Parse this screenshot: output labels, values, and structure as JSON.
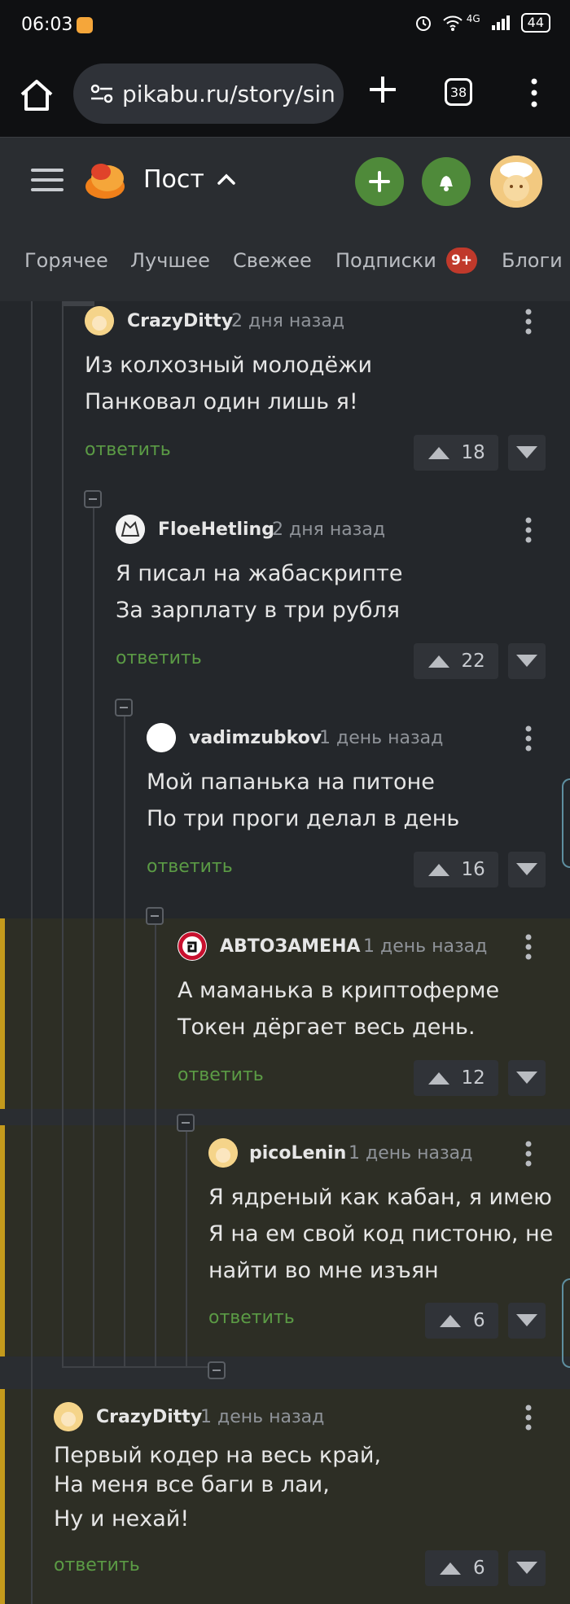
{
  "status": {
    "time": "06:03",
    "network": "4G",
    "battery": "44"
  },
  "browser": {
    "url": "pikabu.ru/story/sin",
    "tabs_count": "38"
  },
  "header": {
    "title": "Пост"
  },
  "nav": {
    "tabs": [
      "Горячее",
      "Лучшее",
      "Свежее",
      "Подписки",
      "Блоги"
    ],
    "badge": "9+"
  },
  "comments": [
    {
      "author": "CrazyDitty",
      "time": "2 дня назад",
      "lines": [
        "Из колхозный молодёжи",
        "Панковал один лишь я!"
      ],
      "reply": "ответить",
      "votes": "18"
    },
    {
      "author": "FloeHetling",
      "time": "2 дня назад",
      "lines": [
        "Я писал на жабаскрипте",
        "За зарплату в три рубля"
      ],
      "reply": "ответить",
      "votes": "22"
    },
    {
      "author": "vadimzubkov",
      "time": "1 день назад",
      "lines": [
        "Мой папанька на питоне",
        "По три проги делал в день"
      ],
      "reply": "ответить",
      "votes": "16"
    },
    {
      "author": "АВТОЗАМЕНА",
      "time": "1 день назад",
      "lines": [
        "А маманька в криптоферме",
        "Токен дёргает весь день."
      ],
      "reply": "ответить",
      "votes": "12"
    },
    {
      "author": "picoLenin",
      "time": "1 день назад",
      "lines": [
        "Я ядреный как кабан, я имею",
        "Я на ем свой код пистоню, не",
        "найти во мне изъян"
      ],
      "reply": "ответить",
      "votes": "6"
    },
    {
      "author": "CrazyDitty",
      "time": "1 день назад",
      "lines": [
        "Первый кодер на весь край,",
        "На меня все баги в лаи,",
        "Ну и нехай!"
      ],
      "reply": "ответить",
      "votes": "6"
    }
  ],
  "colors": {
    "accent_green": "#4f8a3a",
    "reply_green": "#5b9b45",
    "highlight_bar": "#c49a1c",
    "badge_red": "#c0392b"
  }
}
